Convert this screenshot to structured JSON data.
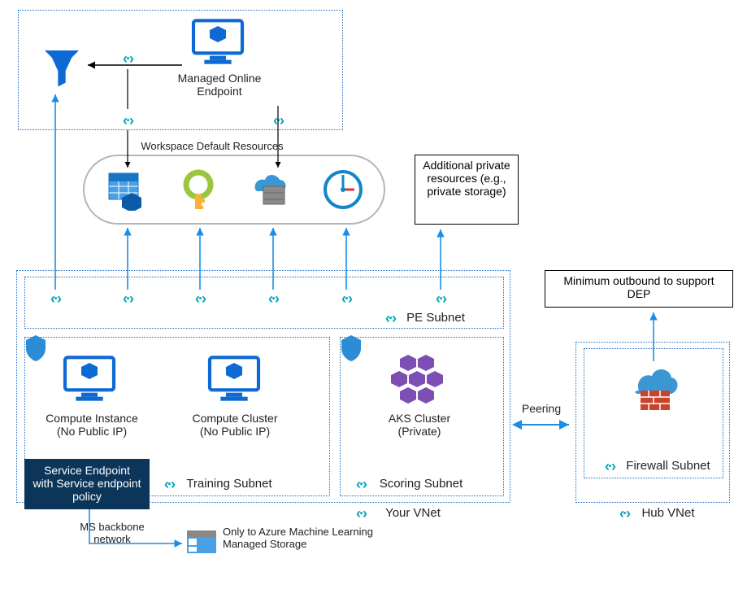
{
  "top": {
    "endpoint": "Managed Online Endpoint",
    "wsResources": "Workspace Default Resources"
  },
  "additionalBox": "Additional private resources (e.g., private storage)",
  "peSubnet": "PE Subnet",
  "training": {
    "computeInstance": "Compute Instance (No Public IP)",
    "computeCluster": "Compute Cluster (No Public IP)",
    "label": "Training Subnet"
  },
  "scoring": {
    "aks": "AKS Cluster (Private)",
    "label": "Scoring Subnet"
  },
  "vnet": "Your VNet",
  "peering": "Peering",
  "hubVnet": "Hub VNet",
  "firewall": "Firewall Subnet",
  "outbound": "Minimum outbound to support DEP",
  "serviceEndpoint": "Service Endpoint with  Service endpoint policy",
  "msBackbone": "MS backbone network",
  "storageNote": "Only to Azure Machine Learning Managed Storage"
}
